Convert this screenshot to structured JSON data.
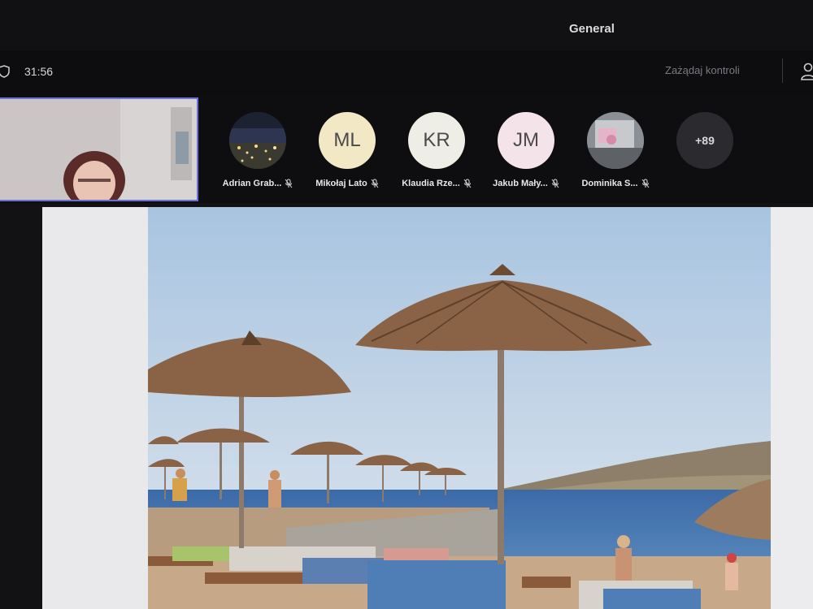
{
  "meeting": {
    "channel": "General",
    "timer": "31:56",
    "request_control": "Zażądaj kontroli",
    "icons": {
      "shield": "shield-icon",
      "people": "people-icon"
    }
  },
  "participants": [
    {
      "initials": "",
      "name": "Adrian Grab...",
      "muted": true,
      "photo": true
    },
    {
      "initials": "ML",
      "name": "Mikołaj Lato",
      "muted": true,
      "color": "#f2e8c6"
    },
    {
      "initials": "KR",
      "name": "Klaudia Rze...",
      "muted": true,
      "color": "#eeeee6"
    },
    {
      "initials": "JM",
      "name": "Jakub Mały...",
      "muted": true,
      "color": "#f5e3ea"
    },
    {
      "initials": "",
      "name": "Dominika S...",
      "muted": true,
      "photo": true
    }
  ],
  "overflow_count": "+89",
  "colors": {
    "accent_border": "#6b6fd8",
    "background": "#0e0e10"
  }
}
